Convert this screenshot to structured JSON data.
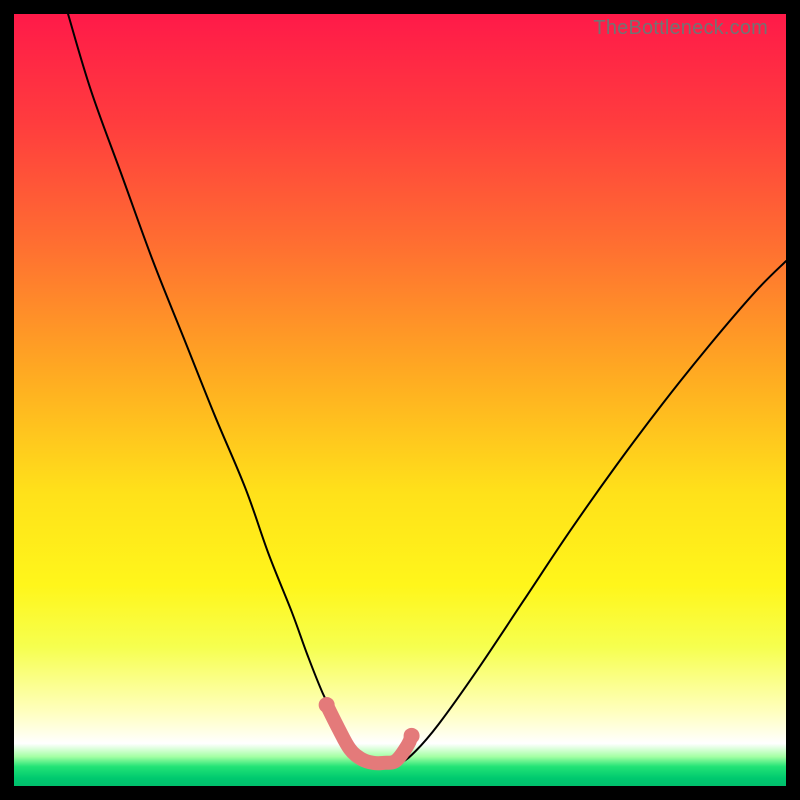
{
  "watermark": "TheBottleneck.com",
  "chart_data": {
    "type": "line",
    "title": "",
    "xlabel": "",
    "ylabel": "",
    "xlim": [
      0,
      100
    ],
    "ylim": [
      0,
      100
    ],
    "gradient_stops": [
      {
        "offset": 0.0,
        "color": "#ff1a49"
      },
      {
        "offset": 0.14,
        "color": "#ff3c3e"
      },
      {
        "offset": 0.3,
        "color": "#ff6f31"
      },
      {
        "offset": 0.46,
        "color": "#ffa822"
      },
      {
        "offset": 0.62,
        "color": "#ffe11a"
      },
      {
        "offset": 0.74,
        "color": "#fff61b"
      },
      {
        "offset": 0.82,
        "color": "#f6ff4f"
      },
      {
        "offset": 0.905,
        "color": "#ffffc0"
      },
      {
        "offset": 0.945,
        "color": "#ffffff"
      },
      {
        "offset": 0.962,
        "color": "#a4ffa4"
      },
      {
        "offset": 0.975,
        "color": "#22e376"
      },
      {
        "offset": 0.99,
        "color": "#00c96f"
      },
      {
        "offset": 1.0,
        "color": "#00bf6c"
      }
    ],
    "series": [
      {
        "name": "bottleneck-curve",
        "x": [
          7.0,
          10.0,
          14.0,
          18.0,
          22.0,
          26.0,
          30.0,
          33.0,
          36.0,
          38.0,
          40.0,
          42.0,
          44.0,
          46.0,
          48.0,
          50.0,
          52.0,
          55.0,
          60.0,
          66.0,
          72.0,
          78.0,
          84.0,
          90.0,
          96.0,
          100.0
        ],
        "y": [
          100.0,
          90.0,
          79.0,
          68.0,
          58.0,
          48.0,
          38.5,
          30.0,
          22.5,
          17.0,
          12.0,
          8.0,
          4.8,
          3.2,
          3.0,
          3.0,
          4.5,
          8.0,
          15.0,
          24.0,
          33.0,
          41.5,
          49.5,
          57.0,
          64.0,
          68.0
        ]
      }
    ],
    "highlight": {
      "name": "bottom-highlight",
      "x_range": [
        40.5,
        51.5
      ],
      "color": "#e47a7a",
      "x": [
        40.5,
        42.0,
        43.5,
        45.0,
        46.5,
        48.0,
        49.5,
        51.0,
        51.5
      ],
      "y": [
        10.5,
        7.5,
        4.8,
        3.5,
        3.0,
        3.0,
        3.3,
        5.3,
        6.5
      ]
    }
  }
}
